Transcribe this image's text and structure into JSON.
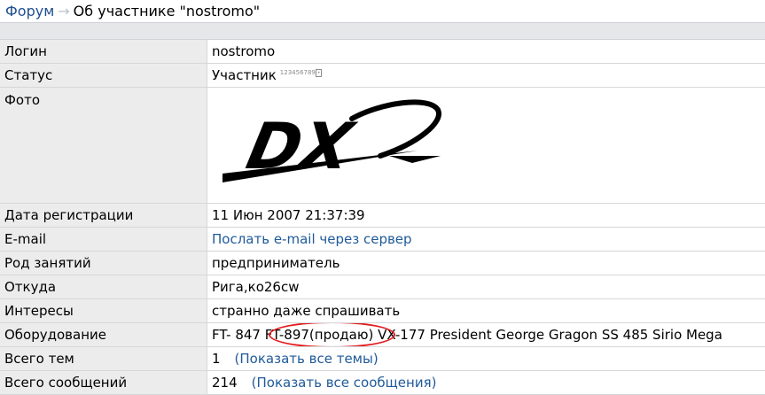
{
  "breadcrumb": {
    "forum": "Форум",
    "separator": "→",
    "title": "Об участнике \"nostromo\""
  },
  "profile": {
    "login": {
      "label": "Логин",
      "value": "nostromo"
    },
    "status": {
      "label": "Статус",
      "value": "Участник",
      "indicator": "123456789"
    },
    "photo": {
      "label": "Фото",
      "logo_text": "DX"
    },
    "registered": {
      "label": "Дата регистрации",
      "value": "11 Июн 2007 21:37:39"
    },
    "email": {
      "label": "E-mail",
      "value": "Послать e-mail через сервер"
    },
    "occupation": {
      "label": "Род занятий",
      "value": "предприниматель"
    },
    "location": {
      "label": "Откуда",
      "value": "Рига,ко26cw"
    },
    "interests": {
      "label": "Интересы",
      "value": "странно даже спрашивать"
    },
    "equipment": {
      "label": "Оборудование",
      "value": "FT- 847 FT-897(продаю) VX-177 President George Gragon SS 485 Sirio Mega"
    },
    "topics": {
      "label": "Всего тем",
      "count": "1",
      "link": "(Показать все темы)"
    },
    "posts": {
      "label": "Всего сообщений",
      "count": "214",
      "link": "(Показать все сообщения)"
    }
  },
  "colors": {
    "link": "#1f5a9a",
    "label_bg": "#ececec",
    "highlight": "#e41a1c"
  }
}
